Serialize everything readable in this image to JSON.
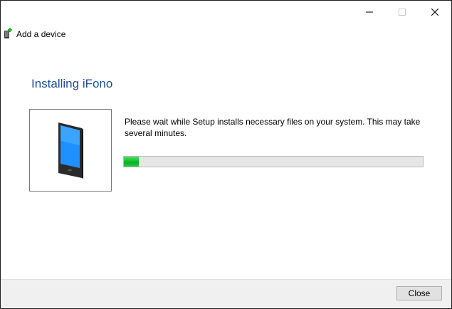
{
  "window": {
    "title": "Add a device",
    "icon": "device-add-icon",
    "controls": [
      "minimize-icon",
      "maximize-icon",
      "close-icon"
    ]
  },
  "main": {
    "title": "Installing iFono",
    "message": "Please wait while Setup installs necessary files on your system. This may take several minutes.",
    "device_image": "smartphone-icon",
    "progress_fraction": 0.05
  },
  "footer": {
    "close_label": "Close"
  },
  "colors": {
    "title": "#1f4e9c",
    "progress": "#06b025",
    "footer_bg": "#f0f0f0"
  }
}
